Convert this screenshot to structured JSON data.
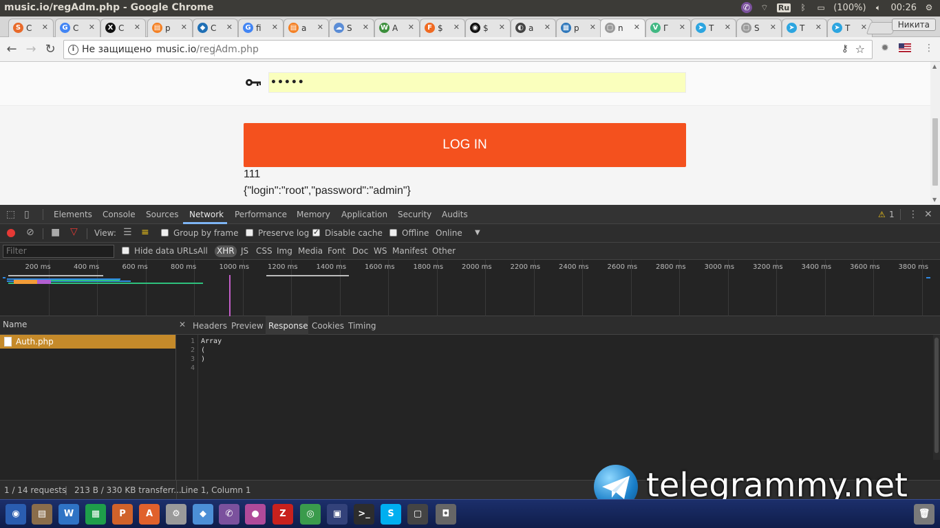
{
  "window": {
    "title": "music.io/regAdm.php - Google Chrome"
  },
  "tray": {
    "lang": "Ru",
    "battery": "(100%)",
    "time": "00:26"
  },
  "tabs": [
    {
      "label": "C",
      "color": "#e86a2a",
      "glyph": "S"
    },
    {
      "label": "C",
      "color": "#4285f4",
      "glyph": "G"
    },
    {
      "label": "C",
      "color": "#111111",
      "glyph": "X"
    },
    {
      "label": "p",
      "color": "#f48024",
      "glyph": "▤"
    },
    {
      "label": "C",
      "color": "#1f6fb5",
      "glyph": "◆"
    },
    {
      "label": "fi",
      "color": "#4285f4",
      "glyph": "G"
    },
    {
      "label": "a",
      "color": "#f48024",
      "glyph": "▤"
    },
    {
      "label": "S",
      "color": "#5b8dd6",
      "glyph": "☁"
    },
    {
      "label": "A",
      "color": "#3c8f3c",
      "glyph": "W"
    },
    {
      "label": "$",
      "color": "#f06a22",
      "glyph": "F"
    },
    {
      "label": "$",
      "color": "#111111",
      "glyph": "◉"
    },
    {
      "label": "a",
      "color": "#444444",
      "glyph": "◐"
    },
    {
      "label": "p",
      "color": "#2e77bb",
      "glyph": "▦"
    },
    {
      "label": "n",
      "color": "#9a9a9a",
      "glyph": "▢"
    },
    {
      "label": "Г",
      "color": "#41b883",
      "glyph": "V"
    },
    {
      "label": "T",
      "color": "#2ca5e0",
      "glyph": "➤"
    },
    {
      "label": "S",
      "color": "#9a9a9a",
      "glyph": "▢"
    },
    {
      "label": "T",
      "color": "#2ca5e0",
      "glyph": "➤"
    },
    {
      "label": "T",
      "color": "#2ca5e0",
      "glyph": "➤"
    }
  ],
  "profile": {
    "name": "Никита"
  },
  "omnibox": {
    "insecure": "Не защищено",
    "host": "music.io",
    "path": "/regAdm.php"
  },
  "page": {
    "password_masked": "•••••",
    "login_button": "LOG IN",
    "output_line1": "111",
    "output_line2": "{\"login\":\"root\",\"password\":\"admin\"}"
  },
  "devtools": {
    "tabs": [
      "Elements",
      "Console",
      "Sources",
      "Network",
      "Performance",
      "Memory",
      "Application",
      "Security",
      "Audits"
    ],
    "active_tab": "Network",
    "warning_count": "1",
    "toolbar": {
      "view_label": "View:",
      "group_by_frame": "Group by frame",
      "preserve_log": "Preserve log",
      "disable_cache": "Disable cache",
      "offline": "Offline",
      "throttle": "Online"
    },
    "filter": {
      "placeholder": "Filter",
      "hide_data_urls": "Hide data URLs",
      "types": [
        "All",
        "XHR",
        "JS",
        "CSS",
        "Img",
        "Media",
        "Font",
        "Doc",
        "WS",
        "Manifest",
        "Other"
      ],
      "active_type": "XHR"
    },
    "timeline_ticks": [
      "200 ms",
      "400 ms",
      "600 ms",
      "800 ms",
      "1000 ms",
      "1200 ms",
      "1400 ms",
      "1600 ms",
      "1800 ms",
      "2000 ms",
      "2200 ms",
      "2400 ms",
      "2600 ms",
      "2800 ms",
      "3000 ms",
      "3200 ms",
      "3400 ms",
      "3600 ms",
      "3800 ms"
    ],
    "name_header": "Name",
    "request_name": "Auth.php",
    "detail_tabs": [
      "Headers",
      "Preview",
      "Response",
      "Cookies",
      "Timing"
    ],
    "active_detail_tab": "Response",
    "response_lines": [
      "Array",
      "(",
      ")",
      ""
    ],
    "line_numbers": [
      "1",
      "2",
      "3",
      "4"
    ],
    "status_requests": "1 / 14 requests",
    "status_transfer": "213 B / 330 KB transferr...",
    "status_cursor": "Line 1, Column 1"
  },
  "watermark": {
    "text": "telegrammy.net"
  },
  "colors": {
    "login_button": "#f4511e",
    "autofill": "#faffbd",
    "selected_row": "#c58a2a",
    "accent": "#7eb5f5"
  }
}
